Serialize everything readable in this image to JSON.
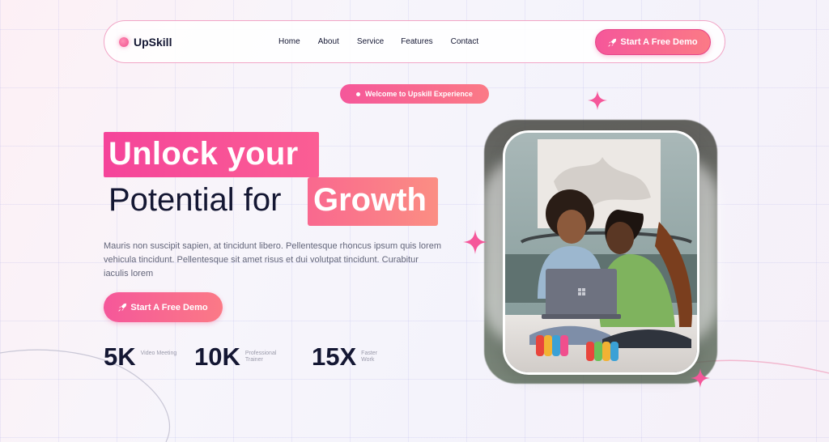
{
  "nav": {
    "logo_text": "UpSkill",
    "links": [
      "Home",
      "About",
      "Service",
      "Features",
      "Contact"
    ],
    "cta_label": "Start A Free Demo"
  },
  "hero": {
    "badge": "Welcome to Upskill Experience",
    "headline_line1": "Unlock your",
    "headline_line2": "Potential for",
    "headline_highlight": "Growth",
    "description": "Mauris non suscipit sapien, at tincidunt libero. Pellentesque rhoncus ipsum quis lorem vehicula tincidunt. Pellentesque sit amet risus et dui volutpat tincidunt. Curabitur iaculis lorem",
    "cta_label": "Start A Free Demo",
    "stats": [
      {
        "value": "5K",
        "label": "Video Meeting"
      },
      {
        "value": "10K",
        "label": "Professional Trainer"
      },
      {
        "value": "15X",
        "label": "Faster Work"
      }
    ]
  },
  "colors": {
    "accent": "#f5579a",
    "accent_end": "#fb7a86",
    "text_dark": "#141733"
  },
  "icons": {
    "cta_icon": "rocket-icon",
    "decor": "sparkle-icon"
  }
}
